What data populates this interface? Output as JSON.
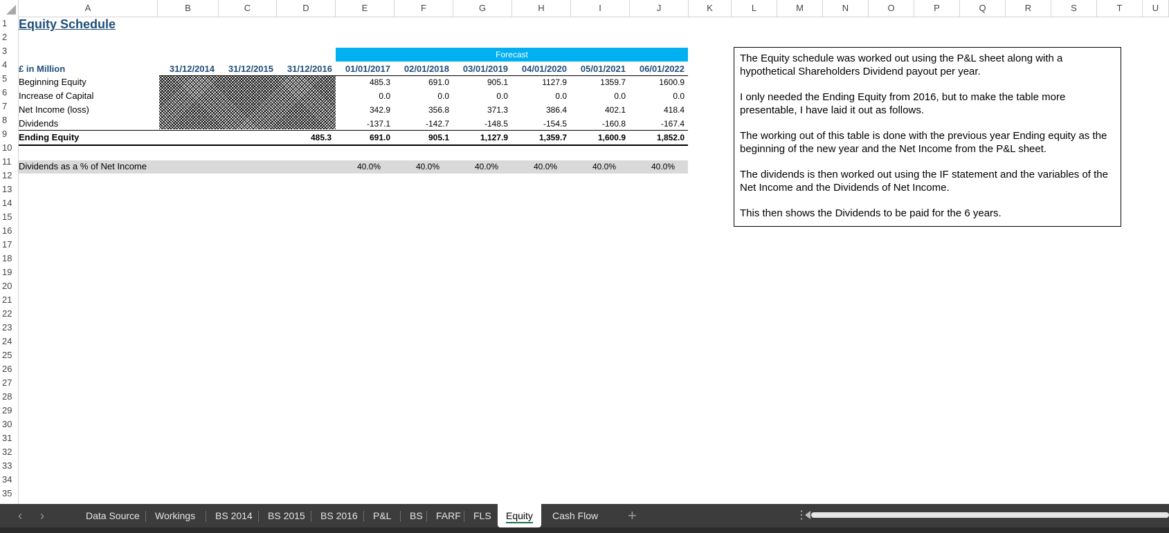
{
  "columns": [
    "A",
    "B",
    "C",
    "D",
    "E",
    "F",
    "G",
    "H",
    "I",
    "J",
    "K",
    "L",
    "M",
    "N",
    "O",
    "P",
    "Q",
    "R",
    "S",
    "T",
    "U"
  ],
  "rows": [
    "1",
    "2",
    "3",
    "4",
    "5",
    "6",
    "7",
    "8",
    "9",
    "10",
    "11",
    "12",
    "13",
    "14",
    "15",
    "16",
    "17",
    "18",
    "19",
    "20",
    "21",
    "22",
    "23",
    "24",
    "25",
    "26",
    "27",
    "28",
    "29",
    "30",
    "31",
    "32",
    "33",
    "34",
    "35"
  ],
  "sheet": {
    "title": "Equity Schedule",
    "forecast_label": "Forecast",
    "unit_label": "£ in Million",
    "dates": [
      "31/12/2014",
      "31/12/2015",
      "31/12/2016",
      "01/01/2017",
      "02/01/2018",
      "03/01/2019",
      "04/01/2020",
      "05/01/2021",
      "06/01/2022"
    ],
    "row_labels": {
      "beginning_equity": "Beginning Equity",
      "increase_capital": "Increase of Capital",
      "net_income": "Net Income (loss)",
      "dividends": "Dividends",
      "ending_equity": "Ending Equity",
      "div_pct": "Dividends as a % of Net Income"
    },
    "beginning_equity": [
      "485.3",
      "691.0",
      "905.1",
      "1127.9",
      "1359.7",
      "1600.9"
    ],
    "increase_capital": [
      "0.0",
      "0.0",
      "0.0",
      "0.0",
      "0.0",
      "0.0"
    ],
    "net_income": [
      "342.9",
      "356.8",
      "371.3",
      "386.4",
      "402.1",
      "418.4"
    ],
    "dividends": [
      "-137.1",
      "-142.7",
      "-148.5",
      "-154.5",
      "-160.8",
      "-167.4"
    ],
    "ending_equity_2016": "485.3",
    "ending_equity": [
      "691.0",
      "905.1",
      "1,127.9",
      "1,359.7",
      "1,600.9",
      "1,852.0"
    ],
    "div_pct": [
      "40.0%",
      "40.0%",
      "40.0%",
      "40.0%",
      "40.0%",
      "40.0%"
    ]
  },
  "notes": [
    "The Equity schedule was worked out using the P&L sheet along with a hypothetical Shareholders Dividend payout per year.",
    "I only needed the Ending Equity from 2016, but to make the table more presentable, I have laid it out as follows.",
    "The working out of this table is done with the previous year Ending equity as the beginning of the new year and the Net Income from the P&L sheet.",
    "The dividends is then worked out using the IF statement and the variables of the Net Income and the Dividends of Net Income.",
    "This then shows the Dividends to be paid for the 6 years."
  ],
  "tabs": [
    "Data Source",
    "Workings",
    "BS 2014",
    "BS 2015",
    "BS 2016",
    "P&L",
    "BS",
    "FARF",
    "FLS",
    "Equity",
    "Cash Flow"
  ],
  "active_tab": "Equity",
  "tab_nav": {
    "prev": "‹",
    "next": "›",
    "add": "+",
    "more": "⋮"
  }
}
